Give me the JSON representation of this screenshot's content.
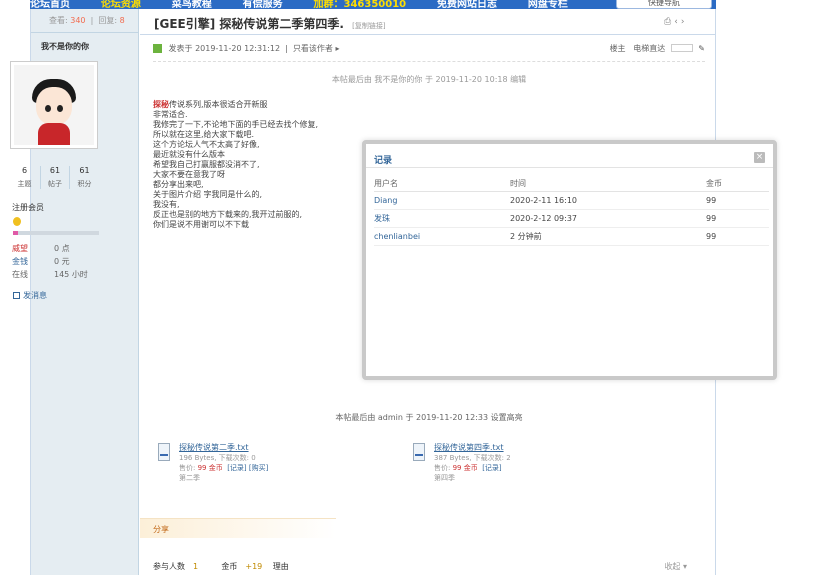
{
  "topnav": {
    "items": [
      {
        "label": "论坛首页",
        "highlight": false
      },
      {
        "label": "论坛资源",
        "highlight": true
      },
      {
        "label": "菜鸟教程",
        "highlight": false
      },
      {
        "label": "有偿服务",
        "highlight": false
      },
      {
        "label": "加群：346350010",
        "highlight": true
      },
      {
        "label": "免费网站日志",
        "highlight": false
      },
      {
        "label": "网盘专栏",
        "highlight": false
      }
    ],
    "right_button": "快捷导航"
  },
  "sidebar": {
    "views_label": "查看:",
    "views_value": "340",
    "replies_label": "回复:",
    "replies_value": "8",
    "author": "我不是你的你",
    "stats": [
      {
        "value": "6",
        "label": "主题"
      },
      {
        "value": "61",
        "label": "帖子"
      },
      {
        "value": "61",
        "label": "积分"
      }
    ],
    "group": "注册会员",
    "level_progress": 0.06,
    "fields": [
      {
        "key": "威望",
        "value": "0 点",
        "red": true
      },
      {
        "key": "金钱",
        "value": "0 元",
        "red": false
      },
      {
        "key": "在线",
        "value": "145 小时",
        "red": false
      }
    ],
    "message_link": "发消息"
  },
  "post": {
    "title": "[GEE引擎] 探秘传说第二季第四季.",
    "title_tag": "[复制链接]",
    "posted": "发表于 2019-11-20 12:31:12",
    "only_author": "只看该作者",
    "floor": "楼主",
    "electric": "电梯直达",
    "edit_note": "本帖最后由 我不是你的你 于 2019-11-20 10:18 编辑",
    "lead_red": "探秘",
    "lines": [
      "传说系列,版本很适合开新服",
      "非常适合.",
      "我修完了一下,不论地下面的手已经去找个修复,",
      "所以就在这里,给大家下载吧.",
      "",
      "这个方论坛人气不太高了好像,",
      "最近就没有什么版本",
      "希望我自己打赢服都没消不了,",
      "",
      "大家不要在意我了呀",
      "都分享出来吧,",
      "",
      "",
      "",
      "",
      "关于图片介绍 字我同是什么的,",
      "我没有,",
      "",
      "反正也是别的地方下载来的,我开过前服的,",
      "",
      "你们是说不用谢可以不下载"
    ],
    "edit_note2": "本帖最后由 admin 于 2019-11-20 12:33 设置高亮"
  },
  "attachments": [
    {
      "name": "探秘传说第二季.txt",
      "size": "196 Bytes, 下载次数: 0",
      "price_label": "售价:",
      "price": "99 金币",
      "buy": "[记录]",
      "extra": "[购买]",
      "note": "第二季"
    },
    {
      "name": "探秘传说第四季.txt",
      "size": "387 Bytes, 下载次数: 2",
      "price_label": "售价:",
      "price": "99 金币",
      "buy": "[记录]",
      "extra": "",
      "note": "第四季"
    }
  ],
  "strip_label": "分享",
  "footer": {
    "participants_label": "参与人数",
    "participants": "1",
    "gold_label": "金币",
    "gold": "+19",
    "reason_label": "理由",
    "collapse": "收起 ▾"
  },
  "modal": {
    "title": "记录",
    "close": "×",
    "columns": [
      "用户名",
      "时间",
      "金币"
    ],
    "rows": [
      {
        "user": "Diang",
        "time": "2020-2-11 16:10",
        "gold": "99"
      },
      {
        "user": "发珠",
        "time": "2020-2-12 09:37",
        "gold": "99"
      },
      {
        "user": "chenlianbei",
        "time": "2 分钟前",
        "gold": "99"
      }
    ]
  },
  "colors": {
    "nav_bg": "#2b6bc4",
    "sidebar_bg": "#e5edf2",
    "accent": "#336699",
    "red": "#cc3333"
  }
}
